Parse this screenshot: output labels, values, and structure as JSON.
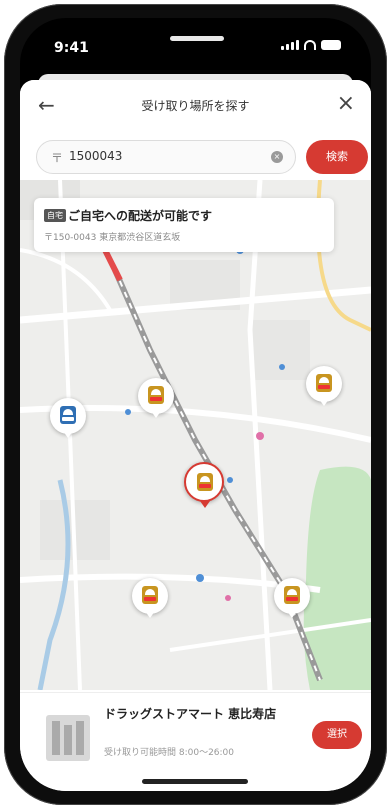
{
  "status_bar": {
    "time": "9:41"
  },
  "nav": {
    "back_icon": "arrow-left",
    "title": "受け取り場所を探す",
    "close_icon": "close"
  },
  "search": {
    "prefix": "〒",
    "value": "1500043",
    "search_button": "検索"
  },
  "delivery_card": {
    "badge": "自宅",
    "headline": "ご自宅への配送が可能です",
    "address": "〒150-0043 東京都渋谷区道玄坂"
  },
  "selected_store": {
    "name": "ドラッグストアマート 恵比寿店",
    "hours": "受け取り可能時間 8:00〜26:00",
    "select_button": "選択"
  },
  "colors": {
    "accent": "#d63a32",
    "pin_store": "#c89520",
    "pin_station": "#2f6fb4",
    "park": "#c6e6c1"
  }
}
